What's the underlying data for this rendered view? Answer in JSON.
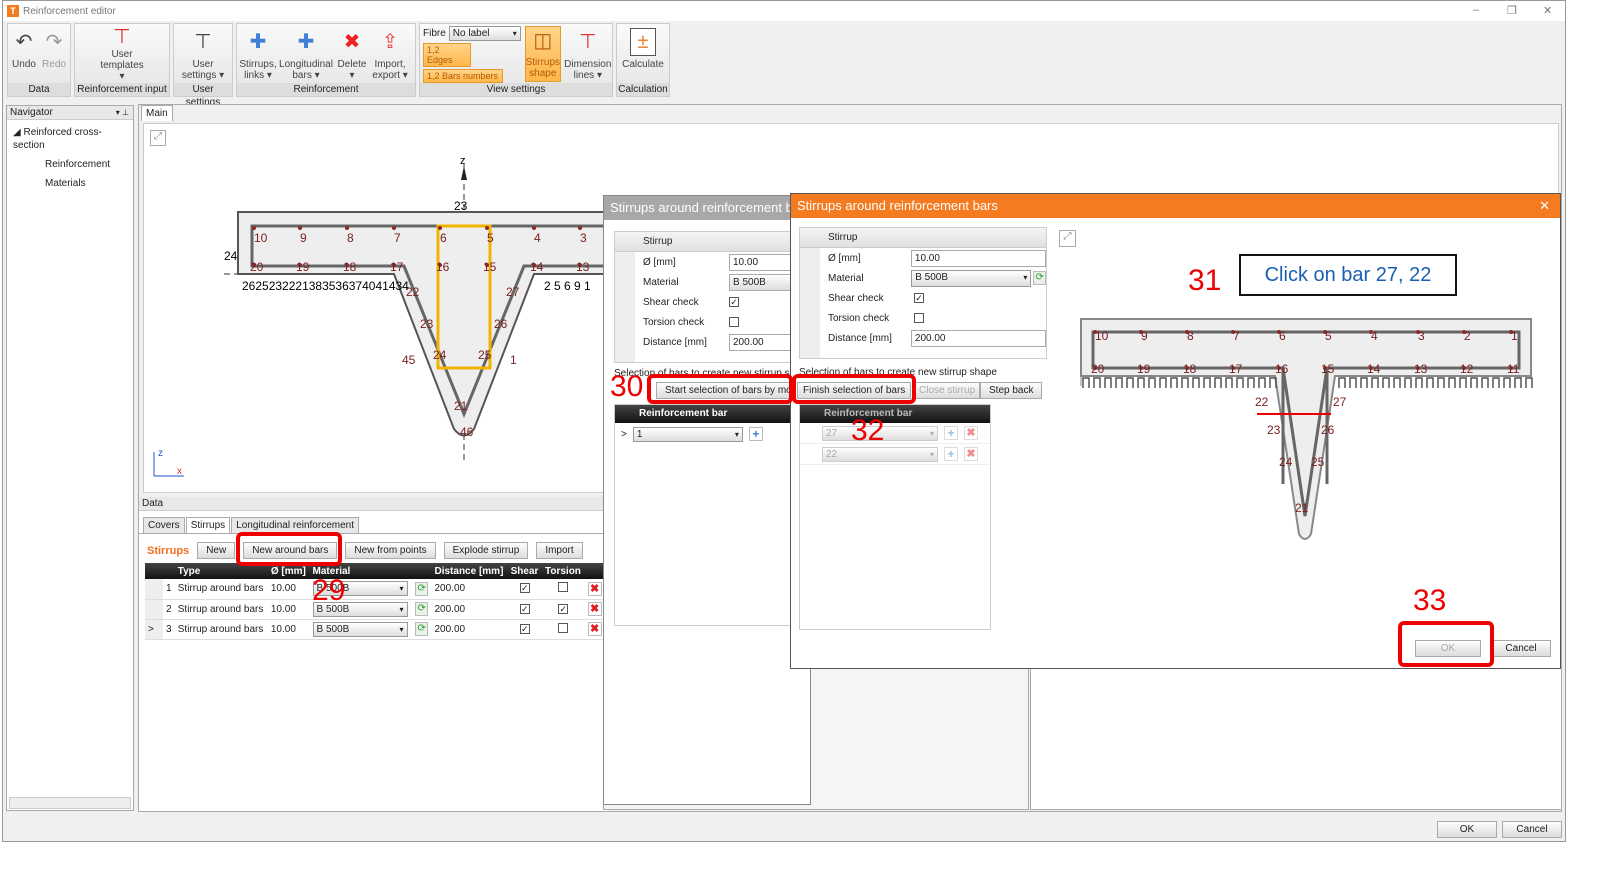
{
  "window": {
    "title": "Reinforcement editor",
    "min": "–",
    "max": "❐",
    "close": "✕"
  },
  "ribbon": {
    "groups": [
      {
        "label": "Data",
        "buttons": [
          {
            "label": "Undo",
            "icon": "undo-icon",
            "glyph": "↶"
          },
          {
            "label": "Redo",
            "icon": "redo-icon",
            "glyph": "↷",
            "disabled": true
          }
        ]
      },
      {
        "label": "Reinforcement input",
        "buttons": [
          {
            "label": "User templates ▾",
            "icon": "user-templates-icon",
            "glyph": "⊤"
          }
        ]
      },
      {
        "label": "User settings",
        "buttons": [
          {
            "label": "User settings ▾",
            "icon": "user-settings-icon",
            "glyph": "⊤"
          }
        ]
      },
      {
        "label": "Reinforcement",
        "buttons": [
          {
            "label": "Stirrups, links ▾",
            "icon": "stirrups-icon",
            "glyph": "✚"
          },
          {
            "label": "Longitudinal bars ▾",
            "icon": "longitudinal-bars-icon",
            "glyph": "✚"
          },
          {
            "label": "Delete ▾",
            "icon": "delete-icon",
            "glyph": "✖"
          },
          {
            "label": "Import, export ▾",
            "icon": "import-export-icon",
            "glyph": "⇪"
          }
        ]
      },
      {
        "label": "View settings"
      },
      {
        "label": "Calculation",
        "buttons": [
          {
            "label": "Calculate",
            "icon": "calculate-icon",
            "glyph": "±"
          }
        ]
      }
    ],
    "view": {
      "fibre_label": "Fibre",
      "fibre_value": "No label",
      "edges": "1,2 Edges",
      "bars_numbers": "1,2 Bars numbers",
      "stirrups_shape": "Stirrups shape",
      "dimension_lines": "Dimension lines ▾"
    }
  },
  "navigator": {
    "title": "Navigator",
    "pin": "📌",
    "items": [
      "Reinforced cross-section",
      "Reinforcement",
      "Materials"
    ]
  },
  "main": {
    "tab": "Main",
    "axis_z": "z",
    "axis_z2": "z",
    "axis_x": "x",
    "top_bars": [
      "10",
      "9",
      "8",
      "7",
      "6",
      "5",
      "4",
      "3"
    ],
    "bottom_bars": [
      "20",
      "19",
      "18",
      "17",
      "16",
      "15",
      "14",
      "13"
    ],
    "web_labels": [
      "22",
      "27",
      "23",
      "26",
      "24",
      "25",
      "21",
      "46",
      "45",
      "1",
      "24",
      "23"
    ],
    "flange_bottom_text": "2625232221383536374041434",
    "flange_right_text": "2  5  6  9 1"
  },
  "data_panel": {
    "title": "Data",
    "tabs": [
      "Covers",
      "Stirrups",
      "Longitudinal reinforcement"
    ],
    "section": "Stirrups",
    "buttons": [
      "New",
      "New around bars",
      "New from points",
      "Explode stirrup",
      "Import"
    ],
    "columns": [
      "",
      "",
      "Type",
      "Ø [mm]",
      "Material",
      "",
      "Distance [mm]",
      "Shear",
      "Torsion",
      ""
    ],
    "rows": [
      {
        "n": "1",
        "type": "Stirrup around bars",
        "d": "10.00",
        "mat": "B 500B",
        "dist": "200.00",
        "shear": true,
        "torsion": false
      },
      {
        "n": "2",
        "type": "Stirrup around bars",
        "d": "10.00",
        "mat": "B 500B",
        "dist": "200.00",
        "shear": true,
        "torsion": true
      },
      {
        "n": "3",
        "type": "Stirrup around bars",
        "d": "10.00",
        "mat": "B 500B",
        "dist": "200.00",
        "shear": true,
        "torsion": false
      }
    ]
  },
  "dialog1": {
    "title": "Stirrups around reinforcement bars",
    "stirrup": "Stirrup",
    "d_label": "Ø [mm]",
    "d": "10.00",
    "mat_label": "Material",
    "mat": "B 500B",
    "shear_label": "Shear check",
    "torsion_label": "Torsion check",
    "dist_label": "Distance [mm]",
    "dist": "200.00",
    "selection_text": "Selection of bars to create new stirrup shape",
    "start_btn": "Start selection of bars by mouse",
    "grid_header": "Reinforcement bar",
    "row_value": "1"
  },
  "dialog2": {
    "title": "Stirrups around reinforcement bars",
    "stirrup": "Stirrup",
    "d_label": "Ø [mm]",
    "d": "10.00",
    "mat_label": "Material",
    "mat": "B 500B",
    "shear_label": "Shear check",
    "torsion_label": "Torsion check",
    "dist_label": "Distance [mm]",
    "dist": "200.00",
    "selection_text": "Selection of bars to create new stirrup shape",
    "finish_btn": "Finish selection of bars",
    "close_btn": "Close stirrup",
    "step_back_btn": "Step back",
    "grid_header": "Reinforcement bar",
    "rows": [
      "27",
      "22"
    ],
    "ok": "OK",
    "cancel": "Cancel",
    "top_bars": [
      "10",
      "9",
      "8",
      "7",
      "6",
      "5",
      "4",
      "3",
      "2",
      "1"
    ],
    "bottom_bars": [
      "20",
      "19",
      "18",
      "17",
      "16",
      "15",
      "14",
      "13",
      "12",
      "11"
    ],
    "web_labels": [
      "22",
      "27",
      "23",
      "26",
      "24",
      "25",
      "21"
    ],
    "callout": "Click on bar 27, 22"
  },
  "annotations": [
    "29",
    "30",
    "31",
    "32",
    "33"
  ],
  "footer": {
    "ok": "OK",
    "cancel": "Cancel"
  }
}
